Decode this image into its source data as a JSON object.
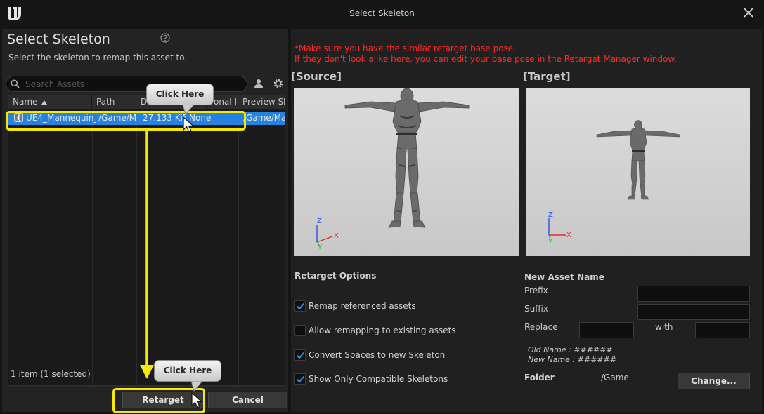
{
  "window": {
    "title": "Select Skeleton"
  },
  "left": {
    "title": "Select Skeleton",
    "description": "Select the skeleton to remap this asset to.",
    "search_placeholder": "Search Assets",
    "columns": [
      "Name",
      "Path",
      "D",
      "onal I",
      "Preview Sk"
    ],
    "row": {
      "name": "UE4_Mannequin_",
      "path": "/Game/M",
      "size": "27.133 KiB",
      "extra": "None",
      "preview": "/Game/Ma"
    },
    "items_count": "1 item (1 selected)",
    "retarget_label": "Retarget",
    "cancel_label": "Cancel"
  },
  "right": {
    "warning_line1": "*Make sure you have the similar retarget base pose.",
    "warning_line2": "If they don't look alike here, you can edit your base pose in the Retarget Manager window.",
    "source_label": "[Source]",
    "target_label": "[Target]",
    "axis": {
      "z": "Z",
      "y": "Y",
      "x": "X"
    },
    "retarget_options_title": "Retarget Options",
    "options": [
      {
        "label": "Remap referenced assets",
        "checked": true
      },
      {
        "label": "Allow remapping to existing assets",
        "checked": false
      },
      {
        "label": "Convert Spaces to new Skeleton",
        "checked": true
      },
      {
        "label": "Show Only Compatible Skeletons",
        "checked": true
      }
    ],
    "new_asset_name_title": "New Asset Name",
    "prefix_label": "Prefix",
    "suffix_label": "Suffix",
    "replace_label": "Replace",
    "with_label": "with",
    "old_name": "Old Name : ######",
    "new_name": "New Name : ######",
    "folder_label": "Folder",
    "folder_value": "/Game",
    "change_label": "Change..."
  },
  "annotations": {
    "callout1": "Click Here",
    "callout2": "Click Here",
    "highlight_color": "#f5ea00"
  },
  "colors": {
    "selection": "#2682e0",
    "warning": "#ff2a2a",
    "accent_check": "#1e9bea"
  }
}
